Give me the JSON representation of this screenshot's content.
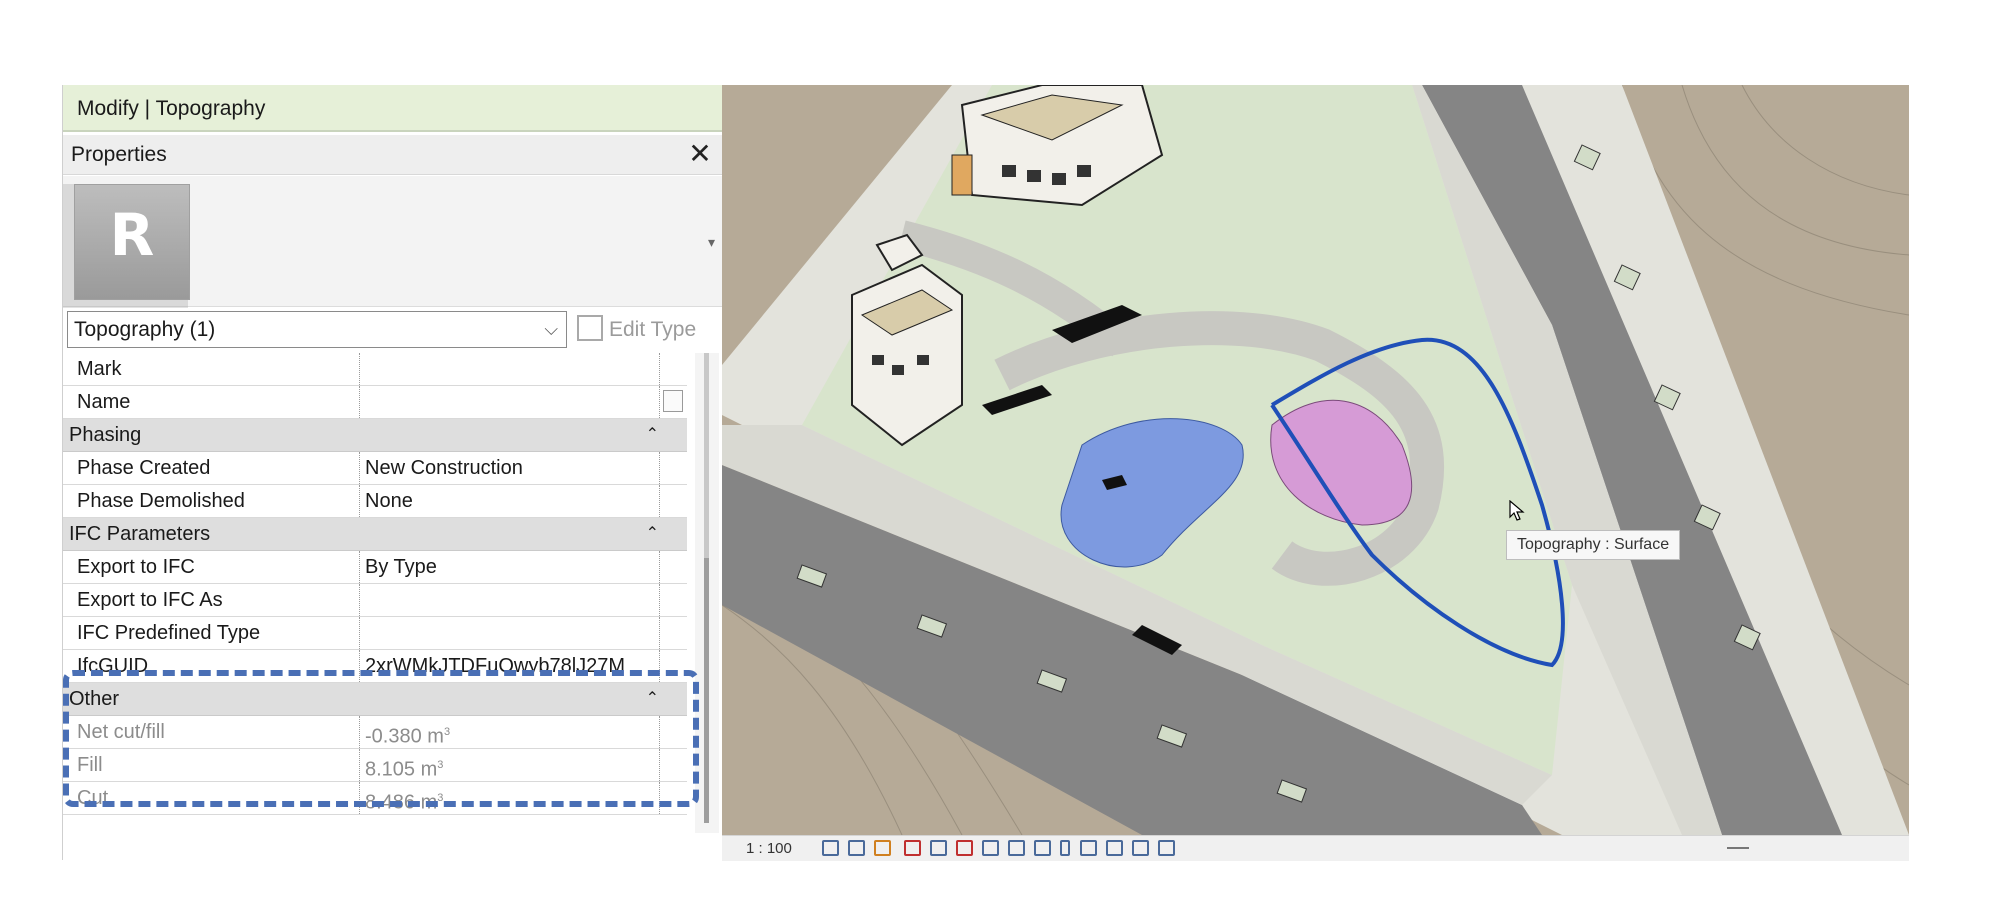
{
  "ribbon": {
    "title": "Modify | Topography"
  },
  "properties": {
    "header": "Properties",
    "close_icon": "close-icon",
    "family_logo_letter": "R",
    "selector_value": "Topography (1)",
    "edit_type_label": "Edit Type"
  },
  "table": {
    "identity_rows": [
      {
        "key": "Mark",
        "value": ""
      },
      {
        "key": "Name",
        "value": ""
      }
    ],
    "phasing": {
      "title": "Phasing",
      "rows": [
        {
          "key": "Phase Created",
          "value": "New Construction"
        },
        {
          "key": "Phase Demolished",
          "value": "None"
        }
      ]
    },
    "ifc": {
      "title": "IFC Parameters",
      "rows": [
        {
          "key": "Export to IFC",
          "value": "By Type"
        },
        {
          "key": "Export to IFC As",
          "value": ""
        },
        {
          "key": "IFC Predefined Type",
          "value": ""
        },
        {
          "key": "IfcGUID",
          "value": "2xrWMkJTDFuQwyb78lJ27M"
        }
      ]
    },
    "other": {
      "title": "Other",
      "rows": [
        {
          "key": "Net cut/fill",
          "value": "-0.380 m",
          "unit_sup": "3"
        },
        {
          "key": "Fill",
          "value": "8.105 m",
          "unit_sup": "3"
        },
        {
          "key": "Cut",
          "value": "8.486 m",
          "unit_sup": "3"
        }
      ]
    }
  },
  "view": {
    "tooltip": "Topography : Surface",
    "scale": "1 : 100"
  },
  "colors": {
    "highlight": "#4a6fb5",
    "ribbon": "#e6f0d8",
    "lawn": "#d9e6cf",
    "pond": "#7d9ae0",
    "play_area": "#d69bd6",
    "road": "#8a8a8a",
    "terrain": "#b7ab98"
  }
}
